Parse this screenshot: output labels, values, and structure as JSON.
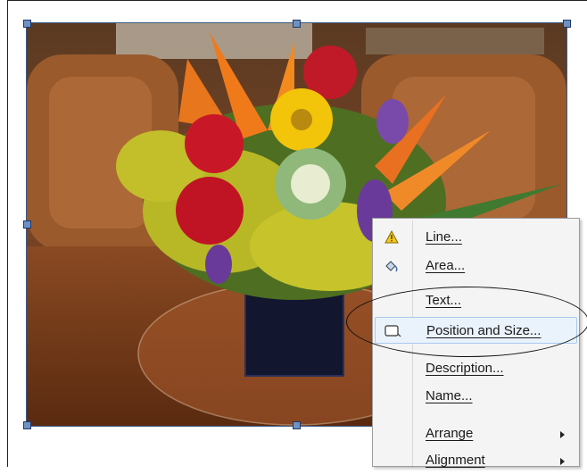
{
  "context_menu": {
    "items": [
      {
        "label": "Line...",
        "icon": "line-warning-icon",
        "submenu": false
      },
      {
        "label": "Area...",
        "icon": "area-fill-icon",
        "submenu": false
      },
      {
        "label": "Text...",
        "icon": "",
        "submenu": false
      },
      {
        "label": "Position and Size...",
        "icon": "position-size-icon",
        "submenu": false,
        "highlighted": true
      },
      {
        "label": "Description...",
        "icon": "",
        "submenu": false
      },
      {
        "label": "Name...",
        "icon": "",
        "submenu": false
      },
      {
        "label": "Arrange",
        "icon": "",
        "submenu": true
      },
      {
        "label": "Alignment",
        "icon": "",
        "submenu": true
      }
    ]
  },
  "colors": {
    "handle": "#6f91c4",
    "highlight": "#eaf2fb",
    "menu_background": "#f4f4f4"
  }
}
